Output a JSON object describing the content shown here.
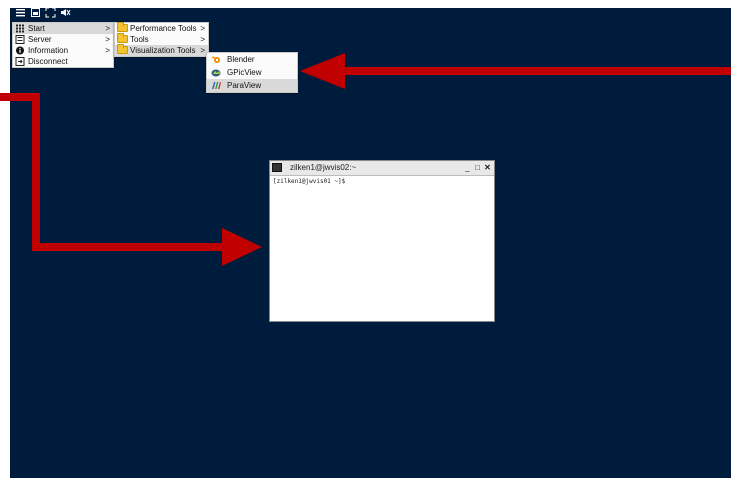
{
  "toolbar": {
    "icons": [
      "hamburger-menu-icon",
      "window-icon",
      "fullscreen-icon",
      "mute-icon"
    ]
  },
  "main_menu": {
    "items": [
      {
        "label": "Start",
        "icon": "grid-icon",
        "has_submenu": true
      },
      {
        "label": "Server",
        "icon": "server-icon",
        "has_submenu": true
      },
      {
        "label": "Information",
        "icon": "info-icon",
        "has_submenu": true
      },
      {
        "label": "Disconnect",
        "icon": "disconnect-icon",
        "has_submenu": false
      }
    ]
  },
  "start_submenu": {
    "items": [
      {
        "label": "Performance Tools",
        "icon": "folder-icon"
      },
      {
        "label": "Tools",
        "icon": "folder-icon"
      },
      {
        "label": "Visualization Tools",
        "icon": "folder-icon"
      }
    ]
  },
  "visualization_submenu": {
    "items": [
      {
        "label": "Blender",
        "icon": "blender-icon"
      },
      {
        "label": "GPicView",
        "icon": "gpicview-icon"
      },
      {
        "label": "ParaView",
        "icon": "paraview-icon"
      }
    ]
  },
  "terminal": {
    "title": "zilken1@jwvis02:~",
    "prompt": "[zilken1@jwvis01 ~]$",
    "minimize": "_",
    "maximize": "□",
    "close": "✕"
  },
  "colors": {
    "desktop": "#001c3c",
    "arrow": "#c00000",
    "menu_bg": "#fbfbfb",
    "menu_highlight": "#d9d9d9"
  }
}
